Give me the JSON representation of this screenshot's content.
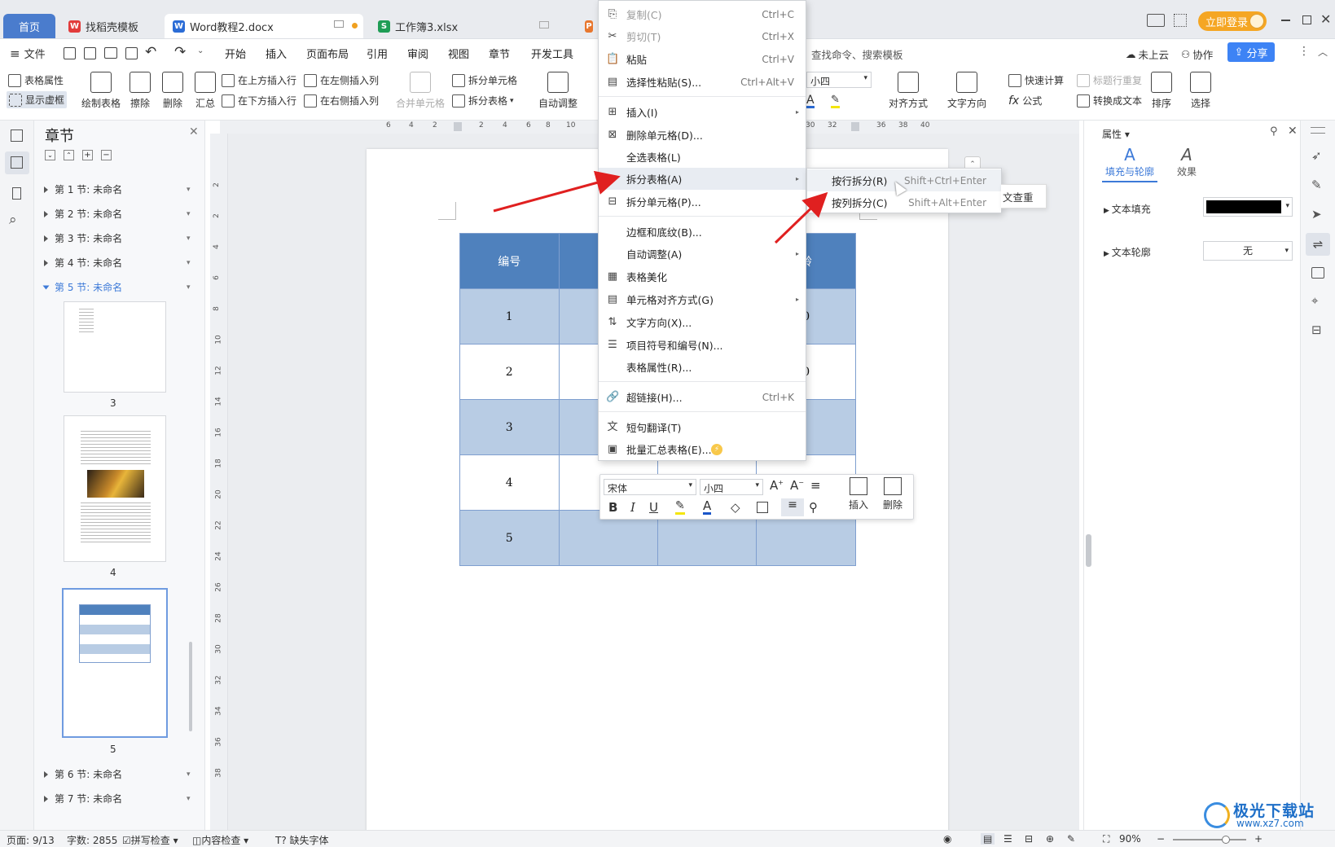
{
  "tabs": {
    "home": "首页",
    "t1": "找稻壳模板",
    "t2": "Word教程2.docx",
    "t3": "工作簿3.xlsx",
    "login": "立即登录"
  },
  "menu": {
    "file": "文件",
    "items": [
      "开始",
      "插入",
      "页面布局",
      "引用",
      "审阅",
      "视图",
      "章节",
      "开发工具"
    ],
    "search": "查找命令、搜索模板",
    "cloud": "未上云",
    "collab": "协作",
    "share": "分享"
  },
  "ribbon": {
    "table_props": "表格属性",
    "show_grid": "显示虚框",
    "draw_table": "绘制表格",
    "erase": "擦除",
    "delete": "删除",
    "summary": "汇总",
    "insert_above": "在上方插入行",
    "insert_below": "在下方插入行",
    "insert_left": "在左侧插入列",
    "insert_right": "在右侧插入列",
    "merge": "合并单元格",
    "split_cell": "拆分单元格",
    "split_table": "拆分表格",
    "auto_adjust": "自动调整",
    "font_size": "小四",
    "align": "对齐方式",
    "text_dir": "文字方向",
    "quick_calc": "快速计算",
    "title_repeat": "标题行重复",
    "formula": "公式",
    "to_text": "转换成文本",
    "sort": "排序",
    "select": "选择"
  },
  "nav": {
    "title": "章节",
    "chapters": [
      "第 1 节: 未命名",
      "第 2 节: 未命名",
      "第 3 节: 未命名",
      "第 4 节: 未命名",
      "第 5 节: 未命名",
      "第 6 节: 未命名",
      "第 7 节: 未命名"
    ],
    "pages": [
      "3",
      "4",
      "5"
    ]
  },
  "hruler": [
    "6",
    "4",
    "2",
    "2",
    "4",
    "6",
    "8",
    "10",
    "30",
    "32",
    "36",
    "38",
    "40"
  ],
  "vruler": [
    "2",
    "2",
    "4",
    "6",
    "8",
    "10",
    "12",
    "14",
    "16",
    "18",
    "20",
    "22",
    "24",
    "26",
    "28",
    "30",
    "32",
    "34",
    "36",
    "38"
  ],
  "table": {
    "header": [
      "编号",
      "",
      "",
      "龄"
    ],
    "rows": [
      [
        "1",
        "",
        "",
        "0"
      ],
      [
        "2",
        "",
        "",
        "0"
      ],
      [
        "3",
        "",
        "",
        ""
      ],
      [
        "4",
        "",
        "",
        ""
      ],
      [
        "5",
        "",
        "",
        ""
      ]
    ],
    "partial": [
      "",
      "",
      "",
      "",
      "",
      "",
      "",
      ""
    ]
  },
  "context_menu": [
    {
      "label": "复制(C)",
      "shortcut": "Ctrl+C",
      "disabled": true
    },
    {
      "label": "剪切(T)",
      "shortcut": "Ctrl+X",
      "disabled": true
    },
    {
      "label": "粘贴",
      "shortcut": "Ctrl+V"
    },
    {
      "label": "选择性粘贴(S)...",
      "shortcut": "Ctrl+Alt+V"
    },
    {
      "label": "插入(I)",
      "shortcut": ""
    },
    {
      "label": "删除单元格(D)...",
      "shortcut": ""
    },
    {
      "label": "全选表格(L)",
      "shortcut": ""
    },
    {
      "label": "拆分表格(A)",
      "shortcut": ""
    },
    {
      "label": "拆分单元格(P)...",
      "shortcut": ""
    },
    {
      "label": "边框和底纹(B)...",
      "shortcut": ""
    },
    {
      "label": "自动调整(A)",
      "shortcut": ""
    },
    {
      "label": "表格美化",
      "shortcut": ""
    },
    {
      "label": "单元格对齐方式(G)",
      "shortcut": ""
    },
    {
      "label": "文字方向(X)...",
      "shortcut": ""
    },
    {
      "label": "项目符号和编号(N)...",
      "shortcut": ""
    },
    {
      "label": "表格属性(R)...",
      "shortcut": ""
    },
    {
      "label": "超链接(H)...",
      "shortcut": "Ctrl+K"
    },
    {
      "label": "短句翻译(T)",
      "shortcut": ""
    },
    {
      "label": "批量汇总表格(E)...",
      "shortcut": ""
    }
  ],
  "submenu": [
    {
      "label": "按行拆分(R)",
      "shortcut": "Shift+Ctrl+Enter"
    },
    {
      "label": "按列拆分(C)",
      "shortcut": "Shift+Alt+Enter"
    }
  ],
  "tooltip_fragment": "文查重",
  "float_toolbar": {
    "font": "宋体",
    "size": "小四",
    "insert": "插入",
    "delete": "删除"
  },
  "right_panel": {
    "title": "属性",
    "tab_fill": "填充与轮廓",
    "tab_effect": "效果",
    "text_fill": "文本填充",
    "text_outline": "文本轮廓",
    "outline_value": "无"
  },
  "status": {
    "page": "页面: 9/13",
    "words": "字数: 2855",
    "spell": "拼写检查",
    "content": "内容检查",
    "missing_font": "缺失字体",
    "zoom": "90%"
  },
  "watermark": "极光下载站",
  "watermark_url": "www.xz7.com",
  "colors": {
    "accent": "#4a7ccd",
    "header_blue": "#4f81bd",
    "alt_blue": "#b8cce4",
    "login": "#f5a623",
    "arrow": "#e02020"
  }
}
